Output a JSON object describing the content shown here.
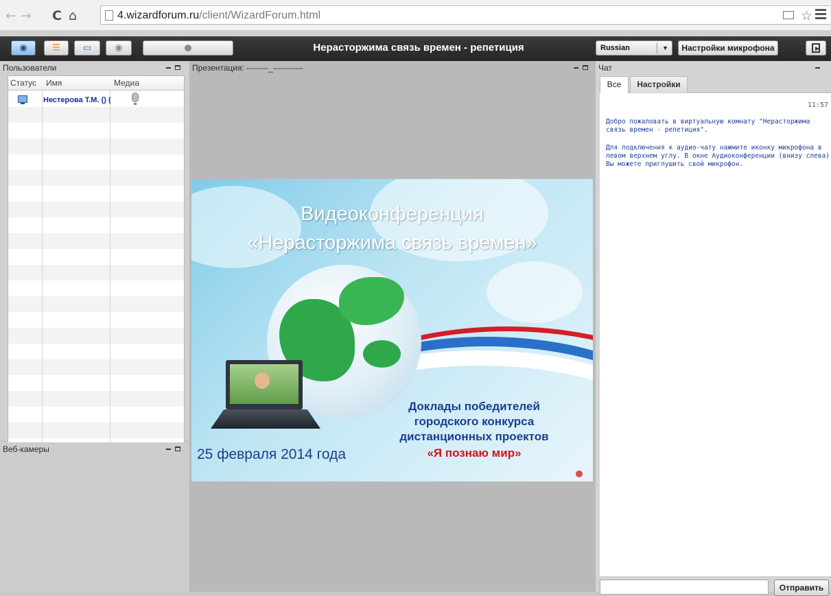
{
  "browser": {
    "url_host": "4.wizardforum.ru",
    "url_path": "/client/WizardForum.html",
    "nav_back_icon": "arrow-left-icon",
    "nav_forward_icon": "arrow-right-icon",
    "reload_icon": "reload-icon",
    "home_icon": "home-icon"
  },
  "toolbar": {
    "title": "Нерасторжима связь времен - репетиция",
    "language": "Russian",
    "mic_settings_label": "Настройки микрофона",
    "buttons": [
      "headset-icon",
      "presenter-icon",
      "desktop-share-icon",
      "webcam-icon",
      "mic-icon"
    ]
  },
  "users_panel": {
    "title": "Пользователи",
    "columns": [
      "Статус",
      "Имя",
      "Медиа"
    ],
    "rows": [
      {
        "status_icon": "desktop-icon",
        "name": "Нестерова Т.М. () (",
        "media_icon": "microphone-icon"
      }
    ]
  },
  "webcams_panel": {
    "title": "Веб-камеры"
  },
  "presentation_panel": {
    "title": "Презентация: --------_-----------",
    "slide": {
      "heading_1": "Видеоконференция",
      "heading_2": "«Нерасторжима связь времен»",
      "date": "25 февраля 2014 года",
      "reports_line_1": "Доклады победителей",
      "reports_line_2": "городского конкурса",
      "reports_line_3": "дистанционных проектов",
      "project_name": "«Я познаю мир»",
      "accent_red": "#d4121c",
      "accent_blue": "#1a3e8c"
    }
  },
  "chat_panel": {
    "title": "Чат",
    "tabs": [
      "Все",
      "Настройки"
    ],
    "timestamp": "11:57",
    "messages": [
      "Добро пожаловать в виртуальную комнату \"Нерасторжима связь времен - репетиция\".",
      "Для подключения к аудио-чату нажмите иконку микрофона в левом верхнем углу. В окне Аудиоконференции (внизу слева) Вы можете приглушить свой микрофон."
    ],
    "input_value": "",
    "send_label": "Отправить"
  }
}
